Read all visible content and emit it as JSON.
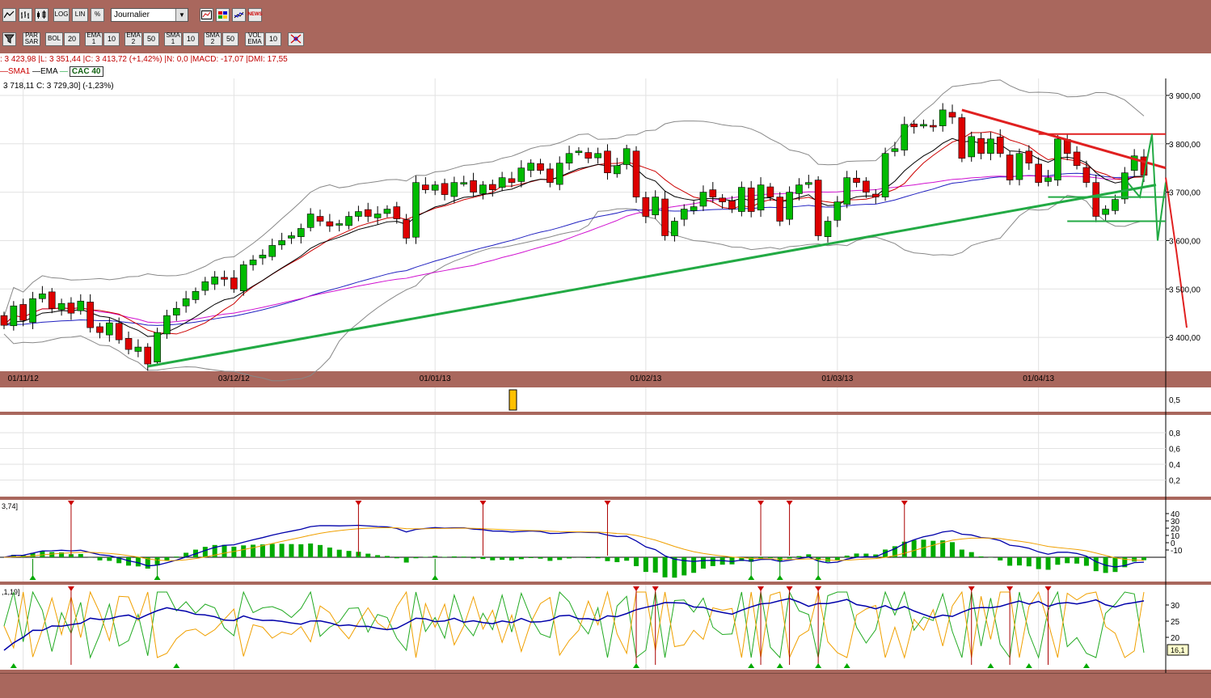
{
  "toolbar1": {
    "buttons": [
      {
        "label": "",
        "icon": "line-chart-icon"
      },
      {
        "label": "",
        "icon": "bar-chart-icon"
      },
      {
        "label": "",
        "icon": "candlestick-icon"
      },
      {
        "label": "LOG",
        "icon": ""
      },
      {
        "label": "LIN",
        "icon": ""
      },
      {
        "label": "%",
        "icon": ""
      }
    ],
    "period_select": "Journalier",
    "right_buttons": [
      "zoom-chart-icon",
      "colors-icon",
      "compare-icon",
      "news-icon"
    ],
    "news_label": "NEWS"
  },
  "toolbar2": {
    "filter_icon": "filter-icon",
    "par_sar": "PAR SAR",
    "bol": "BOL",
    "bol_val": "20",
    "ema1": "EMA 1",
    "ema1_val": "10",
    "ema2": "EMA 2",
    "ema2_val": "50",
    "sma1": "SMA 1",
    "sma1_val": "10",
    "sma2": "SMA 2",
    "sma2_val": "50",
    "vol_ema": "VOL EMA",
    "vol_ema_val": "10",
    "draw_icon": "trendline-tool-icon"
  },
  "info_line": ": 3 423,98 |L: 3 351,44 |C: 3 413,72 (+1,42%) |N: 0,0 |MACD: -17,07 |DMI: 17,55",
  "legend": {
    "sma1": "SMA1",
    "ema": "EMA",
    "instrument": "CAC 40"
  },
  "ohlc_header": "3 718,11  C: 3 729,30] (-1,23%)",
  "macd_label": "3,74]",
  "dmi_label": ",1,19]",
  "dmi_value_box": "16,1",
  "colors": {
    "up": "#00bb00",
    "down": "#dd0000",
    "sma1": "#cc0000",
    "ema": "#000000",
    "ema2": "#2020c0",
    "sma2": "#d010d0",
    "bollinger": "#888888",
    "trend_green": "#22aa44",
    "trend_red": "#e02020",
    "volume_marker": "#ffc000"
  },
  "chart_data": {
    "type": "candlestick",
    "instrument": "CAC 40",
    "period": "Journalier",
    "x_labels": [
      "01/11/12",
      "03/12/12",
      "01/01/13",
      "01/02/13",
      "01/03/13",
      "01/04/13"
    ],
    "y_ticks": [
      3900,
      3800,
      3700,
      3600,
      3500,
      3400
    ],
    "y_tick_labels": [
      "3 900,00",
      "3 800,00",
      "3 700,00",
      "3 600,00",
      "3 500,00",
      "3 400,00"
    ],
    "ylim": [
      3330,
      3935
    ],
    "closes": [
      3425,
      3465,
      3435,
      3480,
      3490,
      3460,
      3470,
      3450,
      3475,
      3420,
      3410,
      3430,
      3395,
      3375,
      3380,
      3345,
      3410,
      3445,
      3460,
      3480,
      3495,
      3515,
      3525,
      3520,
      3500,
      3550,
      3560,
      3570,
      3590,
      3600,
      3610,
      3625,
      3655,
      3640,
      3630,
      3635,
      3650,
      3660,
      3650,
      3655,
      3665,
      3645,
      3605,
      3720,
      3705,
      3715,
      3695,
      3720,
      3720,
      3700,
      3715,
      3705,
      3730,
      3720,
      3750,
      3760,
      3745,
      3720,
      3760,
      3780,
      3785,
      3770,
      3780,
      3740,
      3755,
      3790,
      3690,
      3650,
      3690,
      3610,
      3640,
      3665,
      3670,
      3700,
      3690,
      3680,
      3665,
      3710,
      3660,
      3715,
      3690,
      3640,
      3700,
      3715,
      3720,
      3610,
      3640,
      3680,
      3730,
      3720,
      3700,
      3690,
      3780,
      3790,
      3840,
      3835,
      3840,
      3835,
      3870,
      3855,
      3770,
      3815,
      3780,
      3810,
      3780,
      3725,
      3780,
      3760,
      3720,
      3730,
      3810,
      3780,
      3755,
      3720,
      3650,
      3665,
      3685,
      3740,
      3775,
      3735
    ],
    "scale_labels_mid": [
      "0,5"
    ],
    "scale_labels_osc": [
      "0,8",
      "0,6",
      "0,4",
      "0,2"
    ],
    "macd_ticks": [
      "40",
      "30",
      "20",
      "10",
      "0",
      "-10"
    ],
    "dmi_ticks": [
      "30",
      "25",
      "20"
    ]
  }
}
